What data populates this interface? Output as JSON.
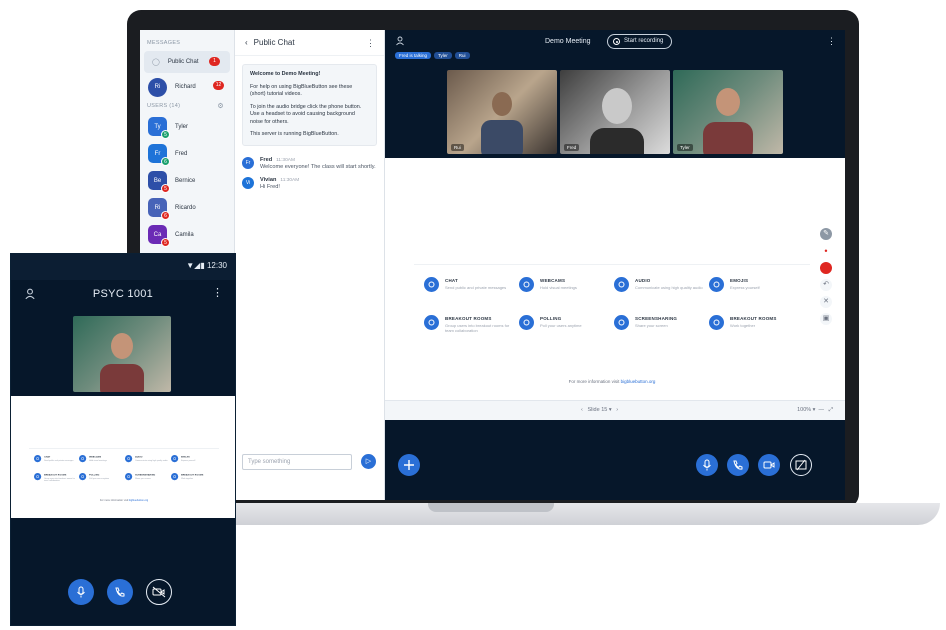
{
  "userlist": {
    "messages_heading": "MESSAGES",
    "public_chat": {
      "label": "Public Chat",
      "badge": "1"
    },
    "private": {
      "label": "Richard",
      "initials": "Ri",
      "badge": "12"
    },
    "users_heading": "USERS (14)",
    "users": [
      {
        "name": "Tyler",
        "initials": "Ty",
        "color": "#2a6fd6",
        "sub": "5",
        "sub_color": "#1aa06d"
      },
      {
        "name": "Fred",
        "initials": "Fr",
        "color": "#1e73d8",
        "sub": "6",
        "sub_color": "#1aa06d"
      },
      {
        "name": "Bernice",
        "initials": "Be",
        "color": "#2d4fa8",
        "sub": "5",
        "sub_color": "#df2721"
      },
      {
        "name": "Ricardo",
        "initials": "Ri",
        "color": "#4763b8",
        "sub": "6",
        "sub_color": "#df2721"
      },
      {
        "name": "Camila",
        "initials": "Ca",
        "color": "#6b2bb5",
        "sub": "5",
        "sub_color": "#df2721"
      }
    ]
  },
  "chat": {
    "title": "Public Chat",
    "welcome": [
      "Welcome to Demo Meeting!",
      "For help on using BigBlueButton see these (short) tutorial videos.",
      "To join the audio bridge click the phone button. Use a headset to avoid causing background noise for others.",
      "This server is running BigBlueButton."
    ],
    "messages": [
      {
        "initials": "Fr",
        "name": "Fred",
        "time": "11:30AM",
        "text": "Welcome everyone! The class will start shortly."
      },
      {
        "initials": "Vi",
        "name": "Vivian",
        "time": "11:30AM",
        "text": "Hi Fred!"
      }
    ],
    "input_placeholder": "Type something"
  },
  "main": {
    "title": "Demo Meeting",
    "record_label": "Start recording",
    "pills": [
      "Fred is talking",
      "Tyler",
      "Rui"
    ],
    "videos": [
      {
        "label": "Rui"
      },
      {
        "label": "Fred"
      },
      {
        "label": "Tyler"
      }
    ],
    "features": [
      {
        "title": "CHAT",
        "desc": "Send public and private messages"
      },
      {
        "title": "WEBCAMS",
        "desc": "Hold visual meetings"
      },
      {
        "title": "AUDIO",
        "desc": "Communicate using high quality audio"
      },
      {
        "title": "EMOJIS",
        "desc": "Express yourself"
      },
      {
        "title": "BREAKOUT ROOMS",
        "desc": "Group users into breakout rooms for team collaboration"
      },
      {
        "title": "POLLING",
        "desc": "Poll your users anytime"
      },
      {
        "title": "SCREENSHARING",
        "desc": "Share your screen"
      },
      {
        "title": "BREAKOUT ROOMS",
        "desc": "Work together"
      }
    ],
    "footer_text": "For more information visit",
    "footer_link": "bigbluebutton.org",
    "slide_label": "Slide 15",
    "zoom": "100%"
  },
  "phone": {
    "time": "12:30",
    "title": "PSYC 1001"
  }
}
